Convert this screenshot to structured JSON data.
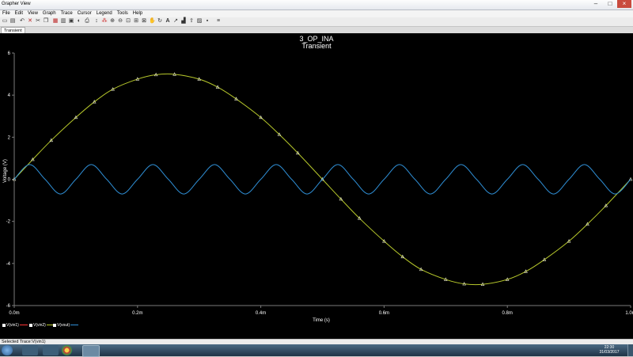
{
  "window": {
    "title": "Grapher View"
  },
  "menu": [
    "File",
    "Edit",
    "View",
    "Graph",
    "Trace",
    "Cursor",
    "Legend",
    "Tools",
    "Help"
  ],
  "tabs": [
    {
      "label": "Transient"
    }
  ],
  "graph": {
    "title": "3_OP_INA",
    "subtitle": "Transient"
  },
  "legend": [
    {
      "label": "V(vin1)",
      "color": "#ff3333"
    },
    {
      "label": "V(vin2)",
      "color": "#b7c82b"
    },
    {
      "label": "V(vout)",
      "color": "#2f8fd6"
    }
  ],
  "status": {
    "text": "Selected Trace:V(vin1)"
  },
  "clock": {
    "time": "22:30",
    "date": "31/03/2017"
  },
  "colors": {
    "background": "#000000",
    "axis": "#7a7a7a",
    "text": "#ffffff",
    "vin_trace": "#b7c82b",
    "vout_trace": "#2f8fd6"
  },
  "chart_data": {
    "type": "line",
    "title": "3_OP_INA",
    "subtitle": "Transient",
    "xlabel": "Time (s)",
    "ylabel": "Voltage (V)",
    "xlim": [
      0,
      0.001
    ],
    "ylim": [
      -6,
      6
    ],
    "x_ticks": [
      {
        "value": 0,
        "label": "0.0m"
      },
      {
        "value": 0.0002,
        "label": "0.2m"
      },
      {
        "value": 0.0004,
        "label": "0.4m"
      },
      {
        "value": 0.0006,
        "label": "0.6m"
      },
      {
        "value": 0.0008,
        "label": "0.8m"
      },
      {
        "value": 0.001,
        "label": "1.0m"
      }
    ],
    "y_ticks": [
      {
        "value": 6,
        "label": "6"
      },
      {
        "value": 4,
        "label": "4"
      },
      {
        "value": 2,
        "label": "2"
      },
      {
        "value": 0,
        "label": "0"
      },
      {
        "value": -2,
        "label": "-2"
      },
      {
        "value": -4,
        "label": "-4"
      },
      {
        "value": -6,
        "label": "-6"
      }
    ],
    "grid": false,
    "legend_position": "bottom-left",
    "series": [
      {
        "name": "V(vin2)",
        "color": "#b7c82b",
        "markers": true,
        "x": [
          0,
          3e-05,
          6e-05,
          0.0001,
          0.00013,
          0.00016,
          0.0002,
          0.00023,
          0.00026,
          0.0003,
          0.00033,
          0.00036,
          0.0004,
          0.00043,
          0.00046,
          0.0005,
          0.00053,
          0.00056,
          0.0006,
          0.00063,
          0.00066,
          0.0007,
          0.00073,
          0.00076,
          0.0008,
          0.00083,
          0.00086,
          0.0009,
          0.00093,
          0.00096,
          0.001
        ],
        "y": [
          0,
          0.94,
          1.85,
          2.94,
          3.68,
          4.28,
          4.76,
          4.97,
          4.99,
          4.76,
          4.38,
          3.82,
          2.94,
          2.13,
          1.25,
          0,
          -0.94,
          -1.85,
          -2.94,
          -3.68,
          -4.28,
          -4.76,
          -4.97,
          -4.99,
          -4.76,
          -4.38,
          -3.82,
          -2.94,
          -2.13,
          -1.25,
          0
        ]
      },
      {
        "name": "V(vout)",
        "color": "#2f8fd6",
        "markers": false,
        "x": [
          0,
          2.5e-05,
          5e-05,
          7.5e-05,
          0.0001,
          0.000125,
          0.00015,
          0.000175,
          0.0002,
          0.000225,
          0.00025,
          0.000275,
          0.0003,
          0.000325,
          0.00035,
          0.000375,
          0.0004,
          0.000425,
          0.00045,
          0.000475,
          0.0005,
          0.000525,
          0.00055,
          0.000575,
          0.0006,
          0.000625,
          0.00065,
          0.000675,
          0.0007,
          0.000725,
          0.00075,
          0.000775,
          0.0008,
          0.000825,
          0.00085,
          0.000875,
          0.0009,
          0.000925,
          0.00095,
          0.000975,
          0.001
        ],
        "y": [
          0,
          0.7,
          0,
          -0.7,
          0,
          0.7,
          0,
          -0.7,
          0,
          0.7,
          0,
          -0.7,
          0,
          0.7,
          0,
          -0.7,
          0,
          0.7,
          0,
          -0.7,
          0,
          0.7,
          0,
          -0.7,
          0,
          0.7,
          0,
          -0.7,
          0,
          0.7,
          0,
          -0.7,
          0,
          0.7,
          0,
          -0.7,
          0,
          0.7,
          0,
          -0.7,
          0
        ]
      }
    ]
  }
}
